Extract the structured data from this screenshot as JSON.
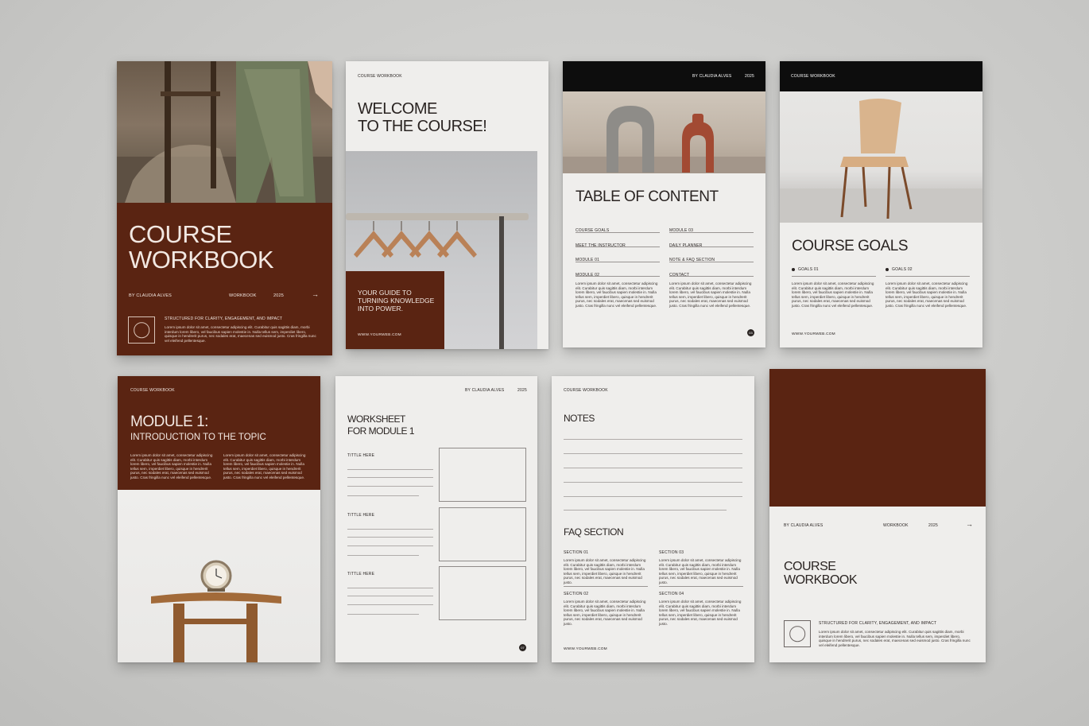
{
  "cover": {
    "title_line1": "COURSE",
    "title_line2": "WORKBOOK",
    "author": "BY CLAUDIA ALVES",
    "label": "WORKBOOK",
    "year": "2025",
    "arrow": "→",
    "tagline": "STRUCTURED FOR CLARITY, ENGAGEMENT, AND IMPACT",
    "body": "Lorem ipsum dolor sit amet, consectetur adipiscing elit. Curabitur quis sagittis diam, morbi interdum lorem libero, vel faucibus sapien molestie in. Nulla tellus sem, imperdiet libero, quisque in hendrerit purus, nec sodales erat, maecenas sed euismod justo. Cras fringilla nunc vel eleifend pellentesque."
  },
  "welcome": {
    "header": "COURSE WORKBOOK",
    "title_line1": "WELCOME",
    "title_line2": "TO THE COURSE!",
    "guide_line1": "YOUR GUIDE TO",
    "guide_line2": "TURNING KNOWLEDGE",
    "guide_line3": "INTO POWER.",
    "web": "WWW.YOURWEB.COM"
  },
  "toc": {
    "author": "BY CLAUDIA ALVES",
    "year": "2025",
    "title": "TABLE OF CONTENT",
    "items_left": [
      "COURSE GOALS",
      "MEET THE INSTRUCTOR",
      "MODULE 01",
      "MODULE 02"
    ],
    "items_right": [
      "MODULE 03",
      "DAILY PLANNER",
      "NOTE & FAQ SECTION",
      "CONTACT"
    ],
    "body": "Lorem ipsum dolor sit amet, consectetur adipiscing elit. Curabitur quis sagittis diam, morbi interdum lorem libero, vel faucibus sapien molestie in. Nulla tellus sem, imperdiet libero, quisque in hendrerit purus, nec sodales erat, maecenas sed euismod justo. Cras fringilla nunc vel eleifend pellentesque.",
    "page": "03"
  },
  "goals": {
    "header": "COURSE WORKBOOK",
    "title": "COURSE GOALS",
    "goal1": "GOALS 01",
    "goal2": "GOALS 02",
    "body": "Lorem ipsum dolor sit amet, consectetur adipiscing elit. Curabitur quis sagittis diam, morbi interdum lorem libero, vel faucibus sapien molestie in. Nulla tellus sem, imperdiet libero, quisque in hendrerit purus, nec sodales erat, maecenas sed euismod justo. Cras fringilla nunc vel eleifend pellentesque.",
    "web": "WWW.YOURWEB.COM"
  },
  "module": {
    "header": "COURSE WORKBOOK",
    "title": "MODULE 1:",
    "subtitle": "INTRODUCTION TO THE TOPIC",
    "body": "Lorem ipsum dolor sit amet, consectetur adipiscing elit. Curabitur quis sagittis diam, morbi interdum lorem libero, vel faucibus sapien molestie in. Nulla tellus sem, imperdiet libero, quisque in hendrerit purus, nec sodales erat, maecenas sed euismod justo. Cras fringilla nunc vel eleifend pellentesque."
  },
  "worksheet": {
    "author": "BY CLAUDIA ALVES",
    "year": "2025",
    "title_line1": "WORKSHEET",
    "title_line2": "FOR MODULE 1",
    "field_label": "TITTLE HERE",
    "page": "07"
  },
  "notes": {
    "header": "COURSE WORKBOOK",
    "title": "NOTES",
    "faq_title": "FAQ SECTION",
    "sections": [
      "SECTION 01",
      "SECTION 03",
      "SECTION 02",
      "SECTION 04"
    ],
    "body": "Lorem ipsum dolor sit amet, consectetur adipiscing elit. Curabitur quis sagittis diam, morbi interdum lorem libero, vel faucibus sapien molestie in. Nulla tellus sem, imperdiet libero, quisque in hendrerit purus, nec sodales erat, maecenas sed euismod justo.",
    "web": "WWW.YOURWEB.COM"
  },
  "back": {
    "author": "BY CLAUDIA ALVES",
    "label": "WORKBOOK",
    "year": "2025",
    "arrow": "→",
    "title_line1": "COURSE",
    "title_line2": "WORKBOOK",
    "tagline": "STRUCTURED FOR CLARITY, ENGAGEMENT, AND IMPACT",
    "body": "Lorem ipsum dolor sit amet, consectetur adipiscing elit. Curabitur quis sagittis diam, morbi interdum lorem libero, vel faucibus sapien molestie in. Nulla tellus sem, imperdiet libero, quisque in hendrerit purus, nec sodales erat, maecenas sed euismod justo. Cras fringilla nunc vel eleifend pellentesque."
  },
  "colors": {
    "brand_brown": "#5a2412",
    "paper": "#efeeec",
    "background": "#c9c9c7"
  }
}
